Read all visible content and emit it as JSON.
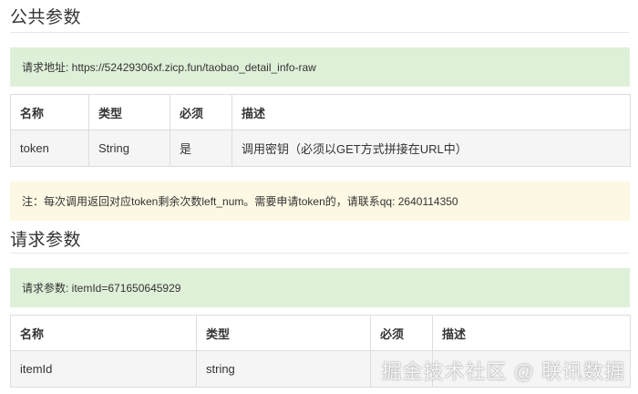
{
  "public_params": {
    "title": "公共参数",
    "request_url_note": "请求地址: https://52429306xf.zicp.fun/taobao_detail_info-raw",
    "headers": [
      "名称",
      "类型",
      "必须",
      "描述"
    ],
    "rows": [
      [
        "token",
        "String",
        "是",
        "调用密钥（必须以GET方式拼接在URL中）"
      ]
    ],
    "notice": "注：每次调用返回对应token剩余次数left_num。需要申请token的，请联系qq: 2640114350"
  },
  "request_params": {
    "title": "请求参数",
    "params_note": "请求参数: itemId=671650645929",
    "headers": [
      "名称",
      "类型",
      "必须",
      "描述"
    ],
    "rows": [
      [
        "itemId",
        "string",
        "",
        ""
      ]
    ]
  },
  "watermark": "掘金技术社区 @ 联讯数据"
}
